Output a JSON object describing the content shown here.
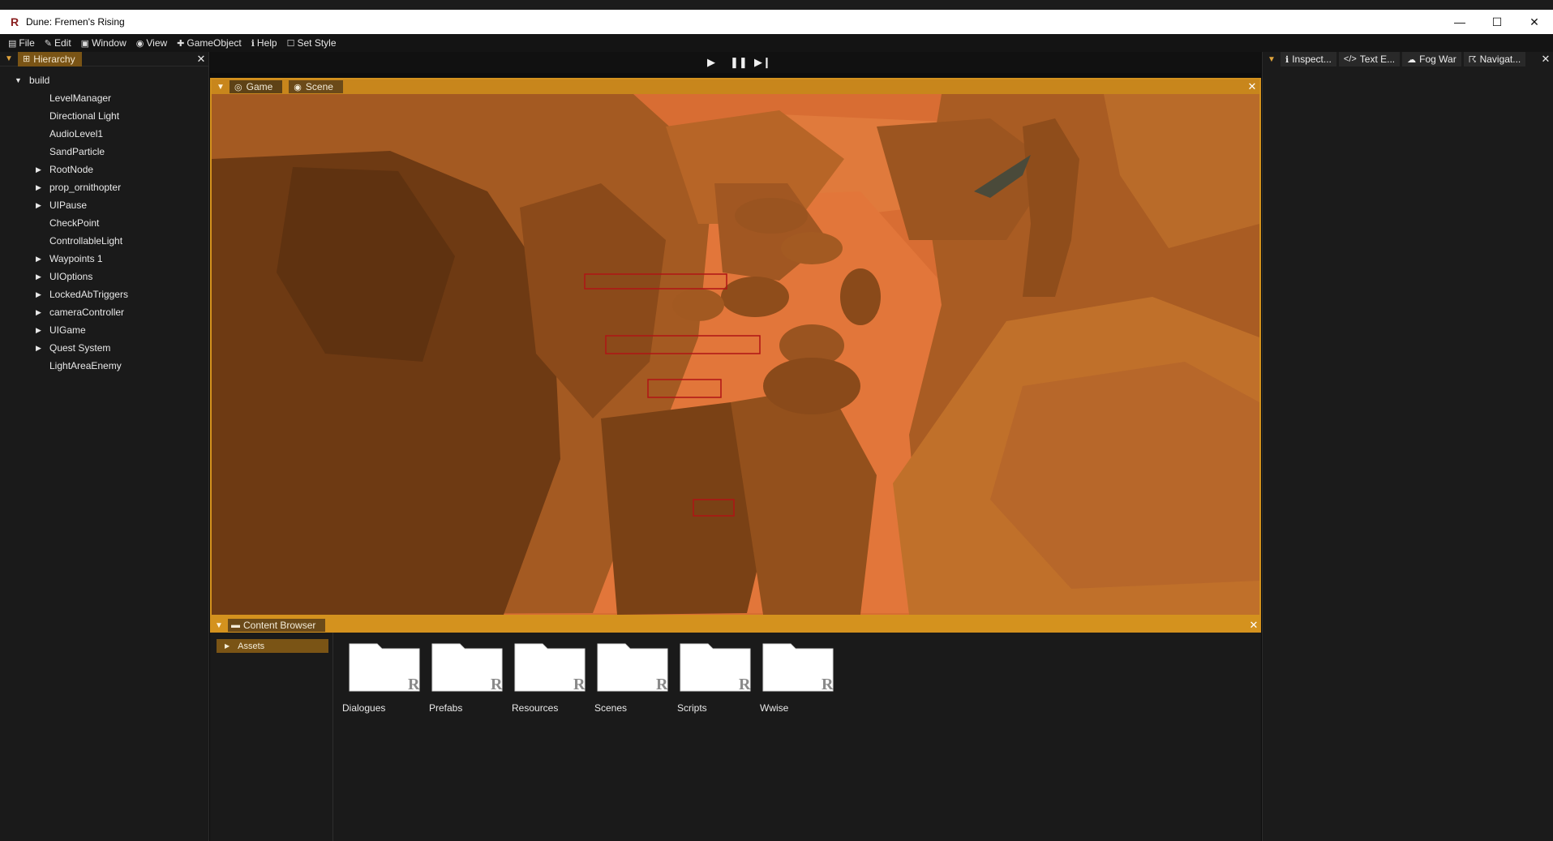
{
  "window": {
    "title": "Dune: Fremen's Rising",
    "logo_glyph": "R",
    "controls": {
      "minimize": "—",
      "maximize": "☐",
      "close": "✕"
    }
  },
  "menu": [
    {
      "icon": "file-icon",
      "glyph": "▤",
      "label": "File"
    },
    {
      "icon": "edit-icon",
      "glyph": "✎",
      "label": "Edit"
    },
    {
      "icon": "window-icon",
      "glyph": "▣",
      "label": "Window"
    },
    {
      "icon": "eye-icon",
      "glyph": "◉",
      "label": "View"
    },
    {
      "icon": "plus-icon",
      "glyph": "✚",
      "label": "GameObject"
    },
    {
      "icon": "info-icon",
      "glyph": "ℹ",
      "label": "Help"
    },
    {
      "icon": "square-icon",
      "glyph": "☐",
      "label": "Set Style"
    }
  ],
  "hierarchy": {
    "tab_label": "Hierarchy",
    "root": "build",
    "items": [
      {
        "label": "LevelManager",
        "expandable": false
      },
      {
        "label": "Directional Light",
        "expandable": false
      },
      {
        "label": "AudioLevel1",
        "expandable": false
      },
      {
        "label": "SandParticle",
        "expandable": false
      },
      {
        "label": "RootNode",
        "expandable": true
      },
      {
        "label": "prop_ornithopter",
        "expandable": true
      },
      {
        "label": "UIPause",
        "expandable": true
      },
      {
        "label": "CheckPoint",
        "expandable": false
      },
      {
        "label": "ControllableLight",
        "expandable": false
      },
      {
        "label": "Waypoints 1",
        "expandable": true
      },
      {
        "label": "UIOptions",
        "expandable": true
      },
      {
        "label": "LockedAbTriggers",
        "expandable": true
      },
      {
        "label": "cameraController",
        "expandable": true
      },
      {
        "label": "UIGame",
        "expandable": true
      },
      {
        "label": "Quest System",
        "expandable": true
      },
      {
        "label": "LightAreaEnemy",
        "expandable": false
      }
    ]
  },
  "playbar": {
    "play": "▶",
    "pause": "❚❚",
    "step": "▶❙"
  },
  "viewport": {
    "tabs": [
      {
        "label": "Game",
        "icon": "gamepad-icon",
        "glyph": "◎"
      },
      {
        "label": "Scene",
        "icon": "eye-icon",
        "glyph": "◉"
      }
    ],
    "colors": {
      "sand": "#d86d33",
      "rock_dark": "#6e3a13",
      "rock_mid": "#a45a22",
      "rock_light": "#c9792e",
      "trigger": "#b01414"
    }
  },
  "content_browser": {
    "tab_label": "Content Browser",
    "tree_root": "Assets",
    "folders": [
      "Dialogues",
      "Prefabs",
      "Resources",
      "Scenes",
      "Scripts",
      "Wwise"
    ]
  },
  "inspector": {
    "tabs": [
      {
        "label": "Inspect...",
        "icon": "info-icon",
        "glyph": "ℹ"
      },
      {
        "label": "Text E...",
        "icon": "code-icon",
        "glyph": "</>"
      },
      {
        "label": "Fog War",
        "icon": "cloud-icon",
        "glyph": "☁"
      },
      {
        "label": "Navigat...",
        "icon": "walk-icon",
        "glyph": "🚶"
      }
    ]
  },
  "theme": {
    "accent": "#d4921e",
    "tab_active": "#7a5415",
    "bg": "#1a1a1a"
  }
}
